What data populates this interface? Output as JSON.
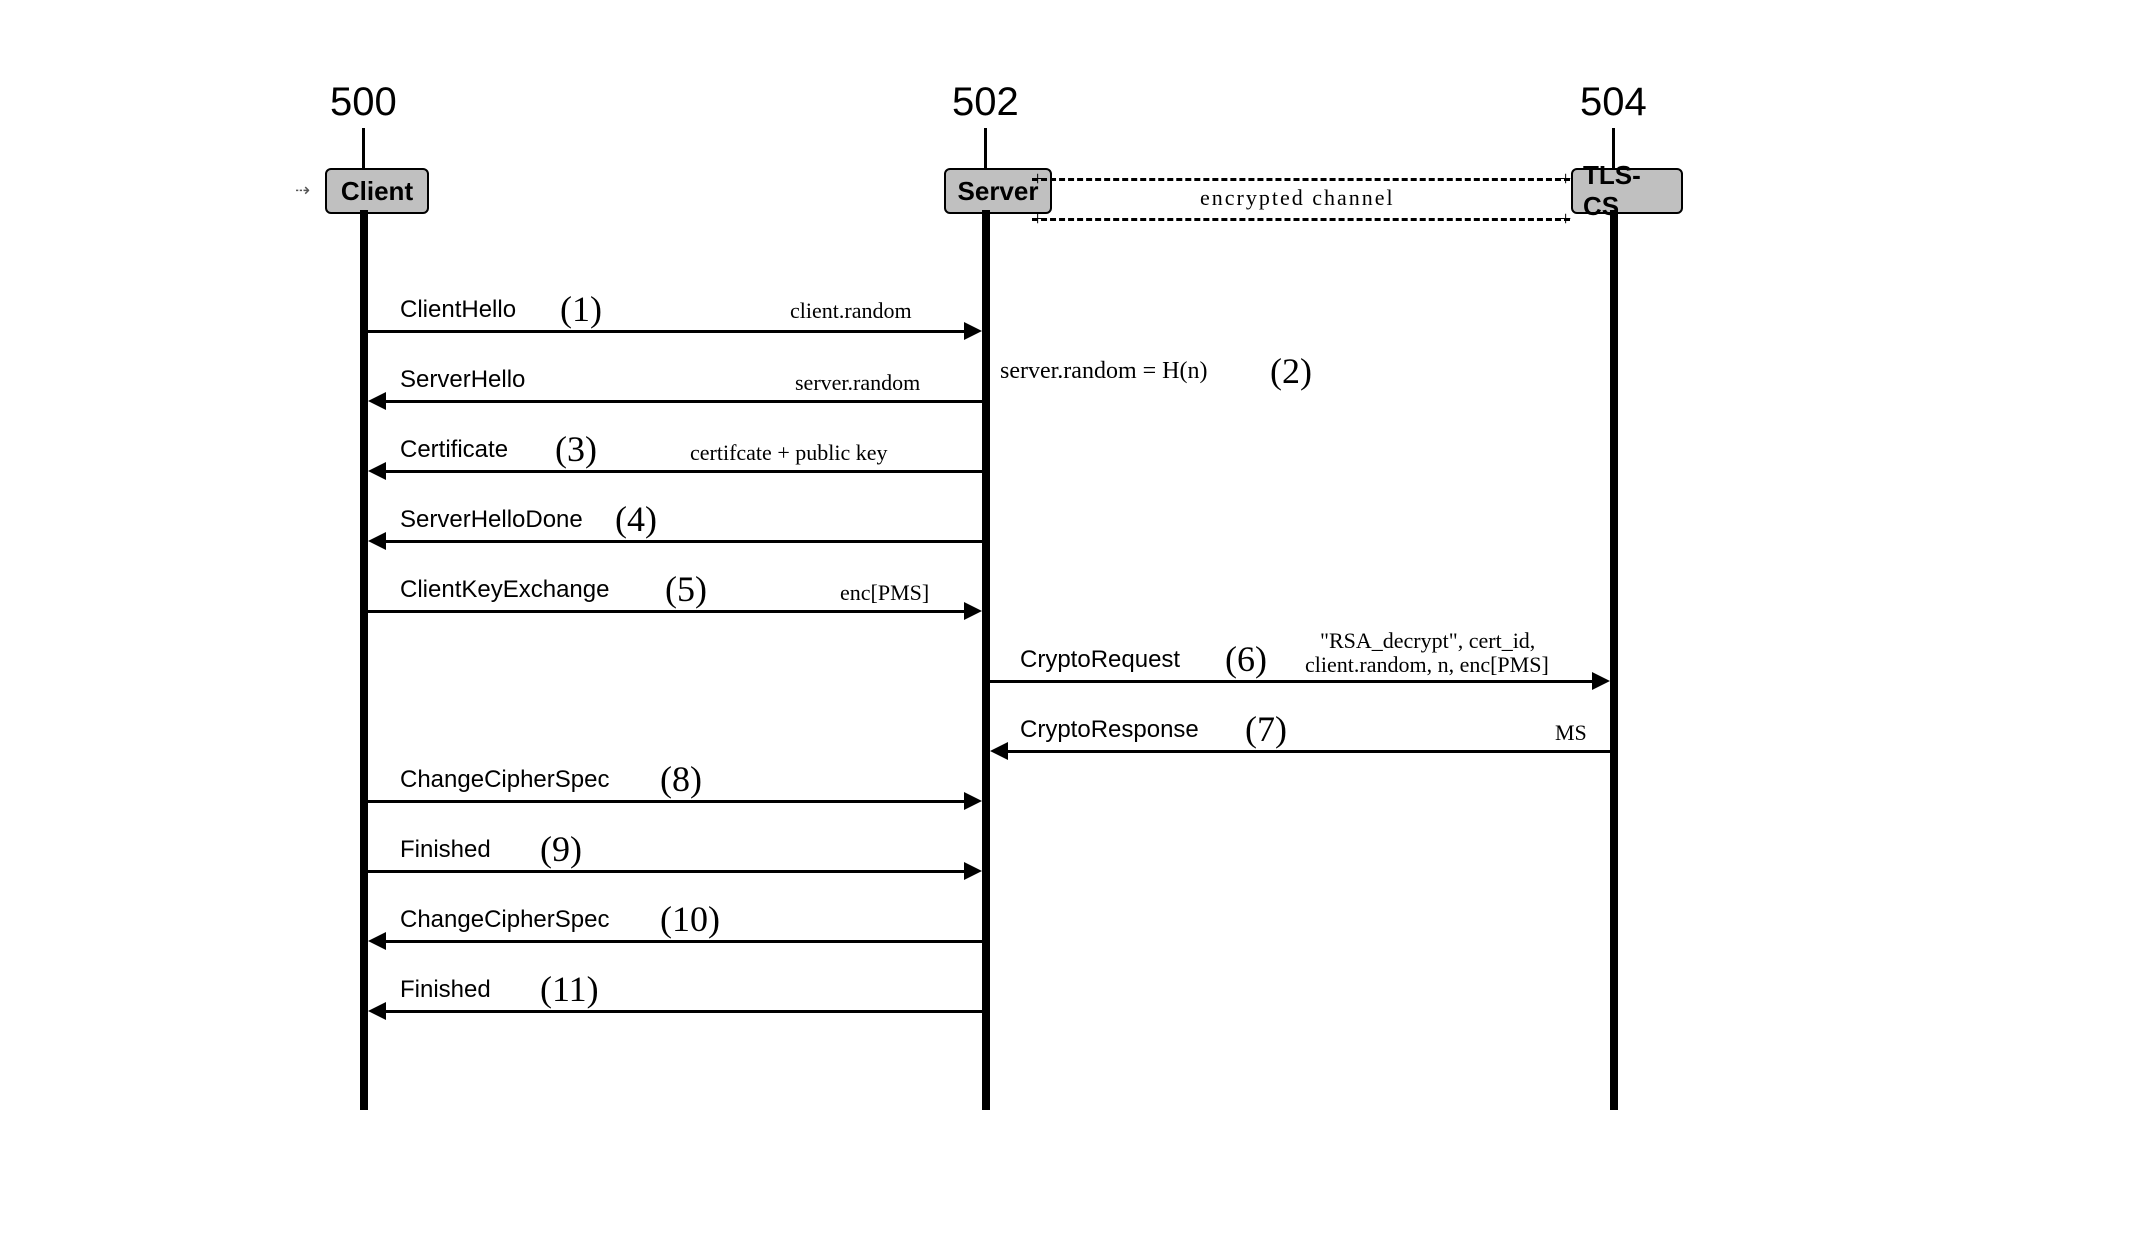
{
  "actors": {
    "client": {
      "ref": "500",
      "label": "Client"
    },
    "server": {
      "ref": "502",
      "label": "Server"
    },
    "tlscs": {
      "ref": "504",
      "label": "TLS-CS"
    }
  },
  "channel_label": "encrypted channel",
  "server_note": "server.random = H(n)",
  "messages": {
    "m1": {
      "name": "ClientHello",
      "step": "(1)",
      "payload": "client.random"
    },
    "m2": {
      "name": "ServerHello",
      "step": "",
      "payload": "server.random",
      "step_right": "(2)"
    },
    "m3": {
      "name": "Certificate",
      "step": "(3)",
      "payload": "certifcate + public key"
    },
    "m4": {
      "name": "ServerHelloDone",
      "step": "(4)",
      "payload": ""
    },
    "m5": {
      "name": "ClientKeyExchange",
      "step": "(5)",
      "payload": "enc[PMS]"
    },
    "m6": {
      "name": "CryptoRequest",
      "step": "(6)",
      "payload_l1": "\"RSA_decrypt\", cert_id,",
      "payload_l2": "client.random, n, enc[PMS]"
    },
    "m7": {
      "name": "CryptoResponse",
      "step": "(7)",
      "payload": "MS"
    },
    "m8": {
      "name": "ChangeCipherSpec",
      "step": "(8)",
      "payload": ""
    },
    "m9": {
      "name": "Finished",
      "step": "(9)",
      "payload": ""
    },
    "m10": {
      "name": "ChangeCipherSpec",
      "step": "(10)",
      "payload": ""
    },
    "m11": {
      "name": "Finished",
      "step": "(11)",
      "payload": ""
    }
  }
}
